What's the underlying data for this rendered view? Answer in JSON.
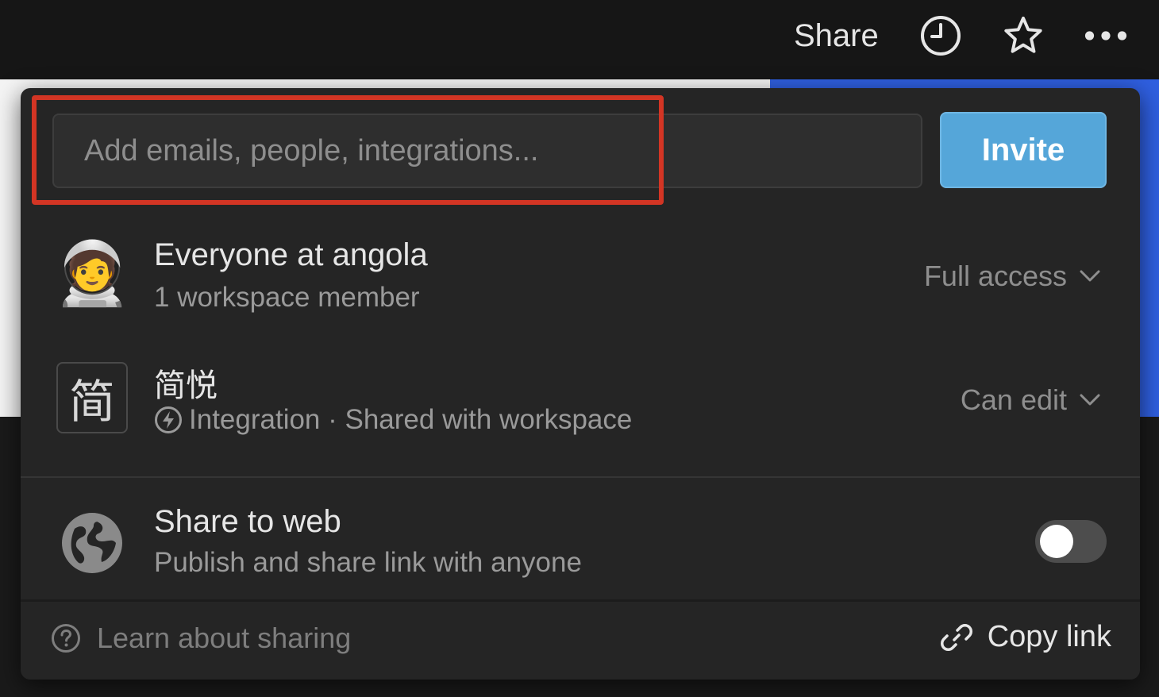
{
  "topbar": {
    "share_label": "Share",
    "icons": {
      "history": "clock-icon",
      "favorite": "star-icon",
      "more": "more-horizontal-icon"
    }
  },
  "share_panel": {
    "invite": {
      "placeholder": "Add emails, people, integrations...",
      "value": "",
      "button_label": "Invite"
    },
    "members": [
      {
        "name": "Everyone at angola",
        "subtitle": "1 workspace member",
        "access": "Full access",
        "avatar": "astronaut-emoji",
        "avatar_glyph": "🧑‍🚀"
      },
      {
        "name": "简悦",
        "subtitle": "Integration · Shared with workspace",
        "access": "Can edit",
        "avatar_glyph": "简",
        "icon": "lightning-icon"
      }
    ],
    "share_to_web": {
      "title": "Share to web",
      "subtitle": "Publish and share link with anyone",
      "enabled": false
    },
    "footer": {
      "learn_label": "Learn about sharing",
      "copy_link_label": "Copy link"
    }
  },
  "colors": {
    "panel_bg": "#252525",
    "invite_button": "#55a6d9",
    "highlight": "#d33524",
    "text_primary": "#e6e6e6",
    "text_secondary": "#9a9a9a"
  }
}
